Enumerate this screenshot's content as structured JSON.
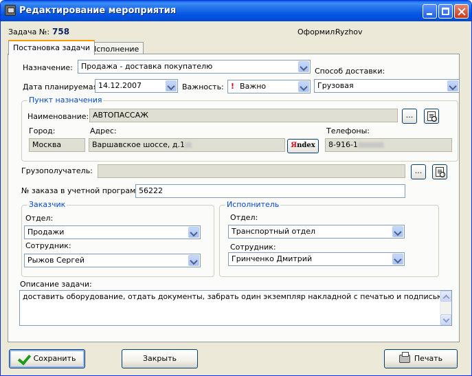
{
  "window": {
    "title": "Редактирование мероприятия"
  },
  "header": {
    "task_label": "Задача №:",
    "task_number": "758",
    "issuer_label": "Оформил:",
    "issuer_value": "Ryzhov"
  },
  "tabs": [
    {
      "label": "Постановка задачи",
      "active": true
    },
    {
      "label": "Исполнение",
      "active": false
    }
  ],
  "form": {
    "purpose_label": "Назначение:",
    "purpose_value": "Продажа - доставка покупателю",
    "delivery_label": "Способ доставки:",
    "delivery_value": "Грузовая",
    "date_label": "Дата планируемая:",
    "date_value": "14.12.2007",
    "importance_label": "Важность:",
    "importance_mark": "!",
    "importance_value": "Важно",
    "destination": {
      "title": "Пункт назначения",
      "name_label": "Наименование:",
      "name_value": "АВТОПАССАЖ",
      "city_label": "Город:",
      "city_value": "Москва",
      "address_label": "Адрес:",
      "address_value": "Варшавское шоссе, д.1",
      "phones_label": "Телефоны:",
      "phones_value": "8-916-1",
      "browse_label": "...",
      "yandex_y": "Я",
      "yandex_rest": "ndex"
    },
    "consignee_label": "Грузополучатель:",
    "consignee_value": "",
    "consignee_browse": "...",
    "order_label": "№ заказа в учетной программе:",
    "order_value": "56222",
    "customer": {
      "title": "Заказчик",
      "dept_label": "Отдел:",
      "dept_value": "Продажи",
      "employee_label": "Сотрудник:",
      "employee_value": "Рыжов Сергей"
    },
    "executor": {
      "title": "Исполнитель",
      "dept_label": "Отдел:",
      "dept_value": "Транспортный отдел",
      "employee_label": "Сотрудник:",
      "employee_value": "Гринченко Дмитрий"
    },
    "description_label": "Описание задачи:",
    "description_value": "доставить оборудование, отдать документы, забрать один экземпляр накладной с печатью и подписью"
  },
  "footer": {
    "save_label": "Сохранить",
    "close_label": "Закрыть",
    "print_label": "Печать"
  },
  "colors": {
    "titlebar": "#0054e3",
    "window_bg": "#ece9d8",
    "group_title": "#0046d5",
    "task_number": "#0a246a",
    "tab_accent": "#ff9a00"
  },
  "icons": [
    "app-icon",
    "minimize-icon",
    "maximize-icon",
    "close-icon",
    "chevron-down-icon",
    "document-view-icon",
    "checkmark-icon",
    "printer-icon",
    "importance-icon"
  ]
}
